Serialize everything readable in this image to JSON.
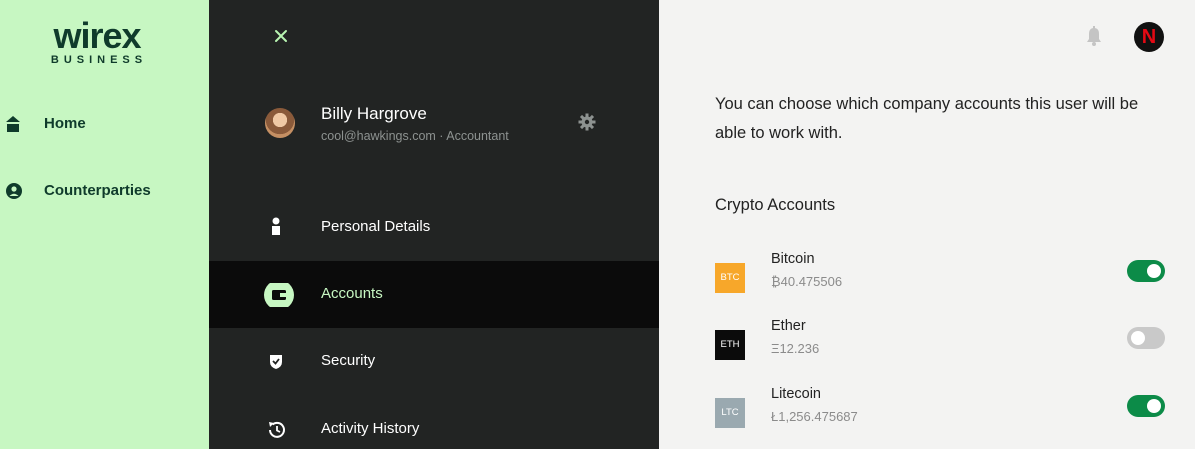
{
  "brand": {
    "word": "wirex",
    "sub": "BUSINESS"
  },
  "leftnav": {
    "items": [
      {
        "label": "Home",
        "icon": "home-icon"
      },
      {
        "label": "Counterparties",
        "icon": "user-circle-icon"
      }
    ]
  },
  "user": {
    "name": "Billy Hargrove",
    "meta": "cool@hawkings.com · Accountant"
  },
  "menu": {
    "items": [
      {
        "label": "Personal Details",
        "icon": "person-icon"
      },
      {
        "label": "Accounts",
        "icon": "wallet-icon"
      },
      {
        "label": "Security",
        "icon": "shield-icon"
      },
      {
        "label": "Activity History",
        "icon": "history-icon"
      }
    ],
    "active": "Accounts"
  },
  "header": {
    "profile_initial": "N"
  },
  "content": {
    "description": "You can choose which company accounts this user will be able to work with.",
    "section_title": "Crypto Accounts",
    "accounts": [
      {
        "code": "BTC",
        "name": "Bitcoin",
        "balance": "₿40.475506",
        "enabled": true,
        "color": "#f7a72a"
      },
      {
        "code": "ETH",
        "name": "Ether",
        "balance": "Ξ12.236",
        "enabled": false,
        "color": "#0b0b0b"
      },
      {
        "code": "LTC",
        "name": "Litecoin",
        "balance": "Ł1,256.475687",
        "enabled": true,
        "color": "#9aa9b0"
      }
    ]
  },
  "colors": {
    "sidebar_bg": "#c7f7c2",
    "panel_bg": "#222423",
    "active_row": "#0b0b0b",
    "toggle_on": "#0c8b48",
    "toggle_off": "#c9c9c9"
  }
}
